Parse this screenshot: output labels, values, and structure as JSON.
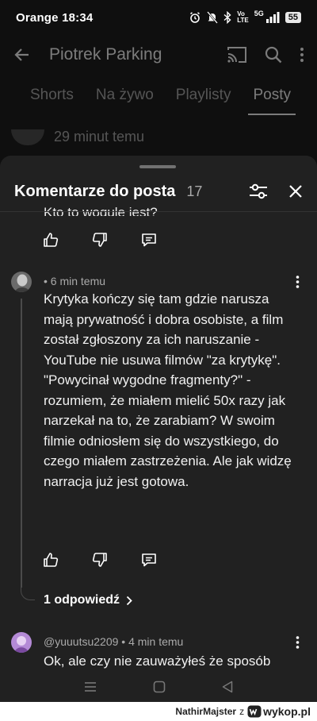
{
  "status_bar": {
    "carrier_time": "Orange 18:34",
    "network": "5G",
    "battery": "55"
  },
  "background_app": {
    "channel_title": "Piotrek Parking",
    "tabs": [
      {
        "label": "Shorts"
      },
      {
        "label": "Na żywo"
      },
      {
        "label": "Playlisty"
      },
      {
        "label": "Posty"
      }
    ],
    "post_time": "29 minut temu"
  },
  "comments_sheet": {
    "title": "Komentarze do posta",
    "count": "17",
    "previous_comment_tail": "Kto to wogule jest?"
  },
  "comments": [
    {
      "meta": "• 6 min temu",
      "text": "Krytyka kończy się tam gdzie narusza mają prywatność i dobra osobiste, a film został zgłoszony za ich naruszanie - YouTube nie usuwa filmów \"za krytykę\".\n\"Powycinał wygodne fragmenty?\" - rozumiem, że miałem mielić 50x razy jak narzekał na to, że zarabiam? W swoim filmie odniosłem się do wszystkiego, do czego miałem zastrzeżenia. Ale jak widzę narracja już jest gotowa.",
      "replies_label": "1 odpowiedź"
    },
    {
      "meta": "@yuuutsu2209 • 4 min temu",
      "text": "Ok, ale czy nie zauważyłeś że sposób"
    }
  ],
  "watermark": {
    "user": "NathirMajster",
    "sep": "z",
    "site": "wykop.pl"
  },
  "colors": {
    "sheet_bg": "#212121",
    "page_bg": "#0f0f0f",
    "text": "#f1f1f1",
    "muted": "#aaaaaa"
  }
}
